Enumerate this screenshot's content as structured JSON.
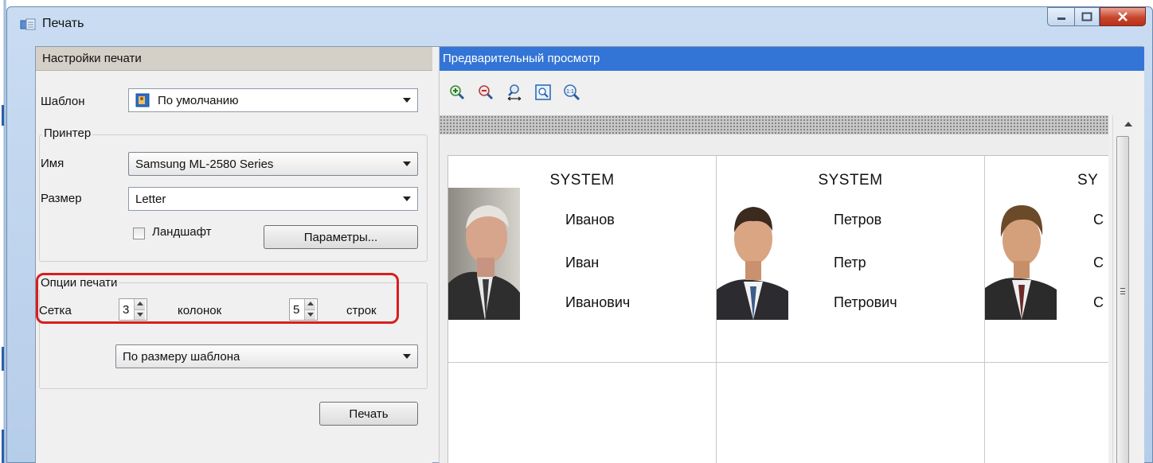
{
  "window": {
    "title": "Печать"
  },
  "settings": {
    "header": "Настройки печати",
    "template_label": "Шаблон",
    "template_value": "По умолчанию",
    "printer_group": "Принтер",
    "name_label": "Имя",
    "name_value": "Samsung ML-2580 Series",
    "size_label": "Размер",
    "size_value": "Letter",
    "landscape_label": "Ландшафт",
    "landscape_checked": false,
    "params_button": "Параметры...",
    "options_group": "Опции печати",
    "grid_label": "Сетка",
    "columns_value": "3",
    "columns_label": "колонок",
    "rows_value": "5",
    "rows_label": "строк",
    "fit_value": "По размеру шаблона",
    "print_button": "Печать"
  },
  "preview": {
    "header": "Предварительный просмотр",
    "tools": [
      "zoom-in-icon",
      "zoom-out-icon",
      "zoom-fit-width-icon",
      "zoom-page-icon",
      "zoom-actual-size-icon"
    ],
    "cards": [
      {
        "system": "SYSTEM",
        "last": "Иванов",
        "first": "Иван",
        "middle": "Иванович"
      },
      {
        "system": "SYSTEM",
        "last": "Петров",
        "first": "Петр",
        "middle": "Петрович"
      },
      {
        "system": "SY",
        "last": "С",
        "first": "С",
        "middle": "С"
      }
    ]
  },
  "colors": {
    "highlight": "#d81e1e",
    "preview_header": "#3375d6",
    "settings_header": "#d4d0c8"
  }
}
